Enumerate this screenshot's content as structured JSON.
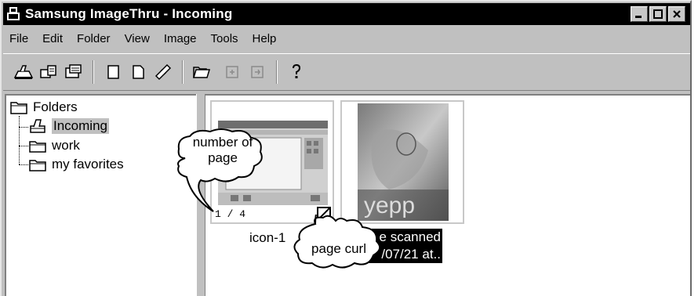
{
  "window": {
    "title": "Samsung ImageThru - Incoming"
  },
  "menu": [
    {
      "id": "file",
      "label": "File"
    },
    {
      "id": "edit",
      "label": "Edit"
    },
    {
      "id": "folder",
      "label": "Folder"
    },
    {
      "id": "view",
      "label": "View"
    },
    {
      "id": "image",
      "label": "Image"
    },
    {
      "id": "tools",
      "label": "Tools"
    },
    {
      "id": "help",
      "label": "Help"
    }
  ],
  "toolbar": {
    "icons": [
      "scan-icon",
      "scan-settings-icon",
      "import-icon",
      "new-page-icon",
      "copy-page-icon",
      "link-icon",
      "open-folder-icon",
      "paste-in-icon",
      "paste-out-icon",
      "help-icon"
    ]
  },
  "folders": {
    "root": "Folders",
    "items": [
      {
        "label": "Incoming",
        "selected": true
      },
      {
        "label": "work",
        "selected": false
      },
      {
        "label": "my favorites",
        "selected": false
      }
    ]
  },
  "thumbnails": [
    {
      "caption": "icon-1",
      "page_counter": "1 / 4"
    },
    {
      "caption_line1": "Image scanned",
      "caption_line2": "2000/07/21 at...",
      "caption_visible_line1": "e scanned",
      "caption_visible_line2": "/07/21 at..",
      "image_text": "yepp"
    }
  ],
  "callouts": {
    "number_of_page": "number of page",
    "page_curl": "page curl"
  }
}
